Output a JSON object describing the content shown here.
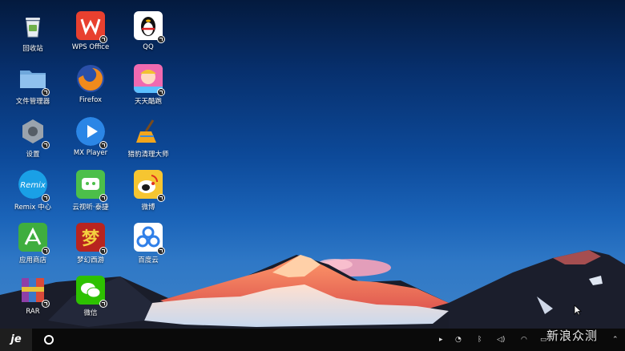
{
  "desktop_icons": [
    {
      "label": "回收站",
      "icon": "recycle-bin-icon"
    },
    {
      "label": "文件管理器",
      "icon": "folder-icon"
    },
    {
      "label": "设置",
      "icon": "settings-gear-icon"
    },
    {
      "label": "Remix 中心",
      "icon": "remix-icon"
    },
    {
      "label": "应用商店",
      "icon": "app-store-icon"
    },
    {
      "label": "RAR",
      "icon": "rar-archive-icon"
    },
    {
      "label": "WPS Office",
      "icon": "wps-office-icon"
    },
    {
      "label": "Firefox",
      "icon": "firefox-icon"
    },
    {
      "label": "MX Player",
      "icon": "mx-player-icon"
    },
    {
      "label": "云视听·泰捷",
      "icon": "tv-app-icon"
    },
    {
      "label": "梦幻西游",
      "icon": "game-icon"
    },
    {
      "label": "微信",
      "icon": "wechat-icon"
    },
    {
      "label": "QQ",
      "icon": "qq-penguin-icon"
    },
    {
      "label": "天天酷跑",
      "icon": "game-character-icon"
    },
    {
      "label": "猎豹清理大师",
      "icon": "broom-icon"
    },
    {
      "label": "微博",
      "icon": "weibo-icon"
    },
    {
      "label": "百度云",
      "icon": "baidu-cloud-icon"
    }
  ],
  "taskbar": {
    "start_label": "je",
    "tray_icons": [
      "play-arrow-icon",
      "clock-icon",
      "bluetooth-icon",
      "volume-icon",
      "wifi-icon",
      "battery-icon",
      "chevron-up-icon"
    ]
  },
  "watermark": "新浪众测"
}
